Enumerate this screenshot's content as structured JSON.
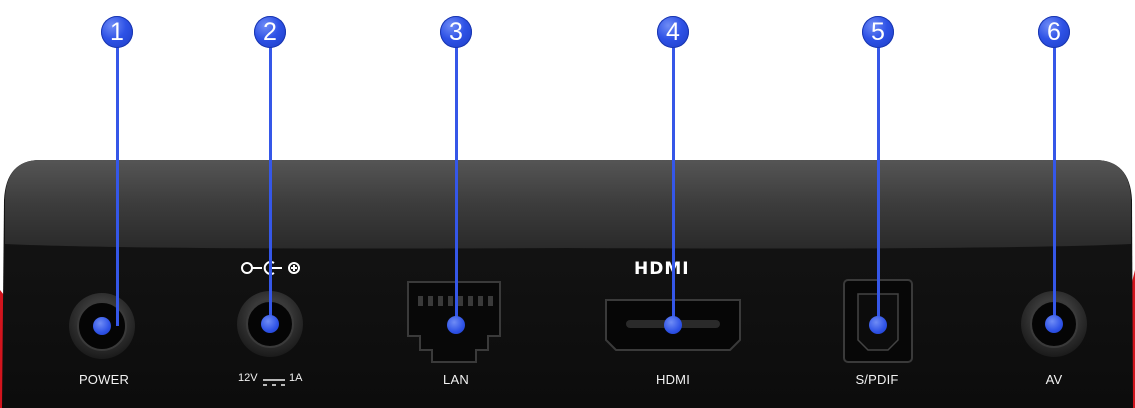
{
  "callouts": [
    {
      "num": "1",
      "port": "POWER"
    },
    {
      "num": "2",
      "port": ""
    },
    {
      "num": "3",
      "port": "LAN"
    },
    {
      "num": "4",
      "port": "HDMI"
    },
    {
      "num": "5",
      "port": "S/PDIF"
    },
    {
      "num": "6",
      "port": "AV"
    }
  ],
  "dc_spec": {
    "voltage": "12V",
    "current": "1A"
  },
  "hdmi_logo_text": "HDMI",
  "colors": {
    "callout_blue": "#2e52e6",
    "device_body": "#151515",
    "accent_red": "#d2141d"
  }
}
